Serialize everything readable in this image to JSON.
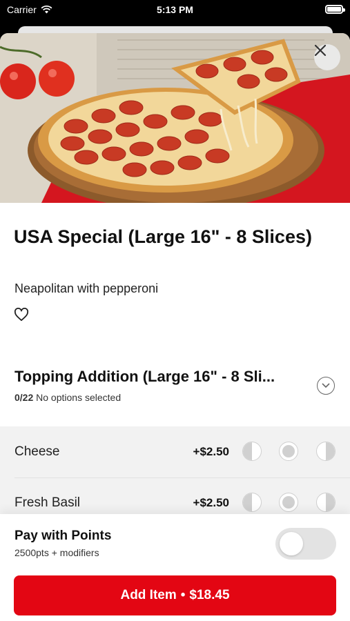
{
  "status_bar": {
    "carrier": "Carrier",
    "time": "5:13 PM"
  },
  "item": {
    "title": "USA Special (Large 16\" - 8 Slices)",
    "description": "Neapolitan with pepperoni"
  },
  "section": {
    "title": "Topping Addition (Large 16\" - 8 Sli...",
    "count": "0/22",
    "status": "No options selected"
  },
  "options": [
    {
      "name": "Cheese",
      "price": "+$2.50"
    },
    {
      "name": "Fresh Basil",
      "price": "+$2.50"
    }
  ],
  "points": {
    "title": "Pay with Points",
    "subtitle": "2500pts + modifiers",
    "enabled": false
  },
  "add_button": {
    "label": "Add Item",
    "separator": "•",
    "price": "$18.45"
  },
  "colors": {
    "accent": "#e30613",
    "toggle_off": "#e3e3e3"
  }
}
